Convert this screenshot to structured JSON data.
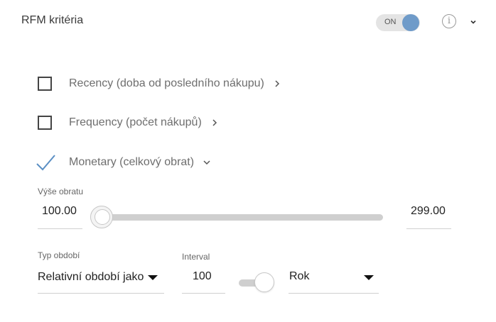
{
  "header": {
    "title": "RFM kritéria",
    "toggle_label": "ON",
    "toggle_on": true,
    "toggle_color": "#6f9bc9",
    "info_icon": "info-icon",
    "collapse_icon": "chevron-down-icon"
  },
  "criteria": [
    {
      "label": "Recency (doba od posledního nákupu)",
      "checked": false,
      "expanded": false
    },
    {
      "label": "Frequency (počet nákupů)",
      "checked": false,
      "expanded": false
    },
    {
      "label": "Monetary (celkový obrat)",
      "checked": true,
      "expanded": true
    }
  ],
  "monetary": {
    "range_label": "Výše obratu",
    "min_value": "100.00",
    "max_value": "299.00",
    "period_type_label": "Typ období",
    "period_type_value": "Relativní období jako",
    "interval_label": "Interval",
    "interval_value": "100",
    "unit_value": "Rok"
  },
  "colors": {
    "check_accent": "#5b8fc4"
  }
}
